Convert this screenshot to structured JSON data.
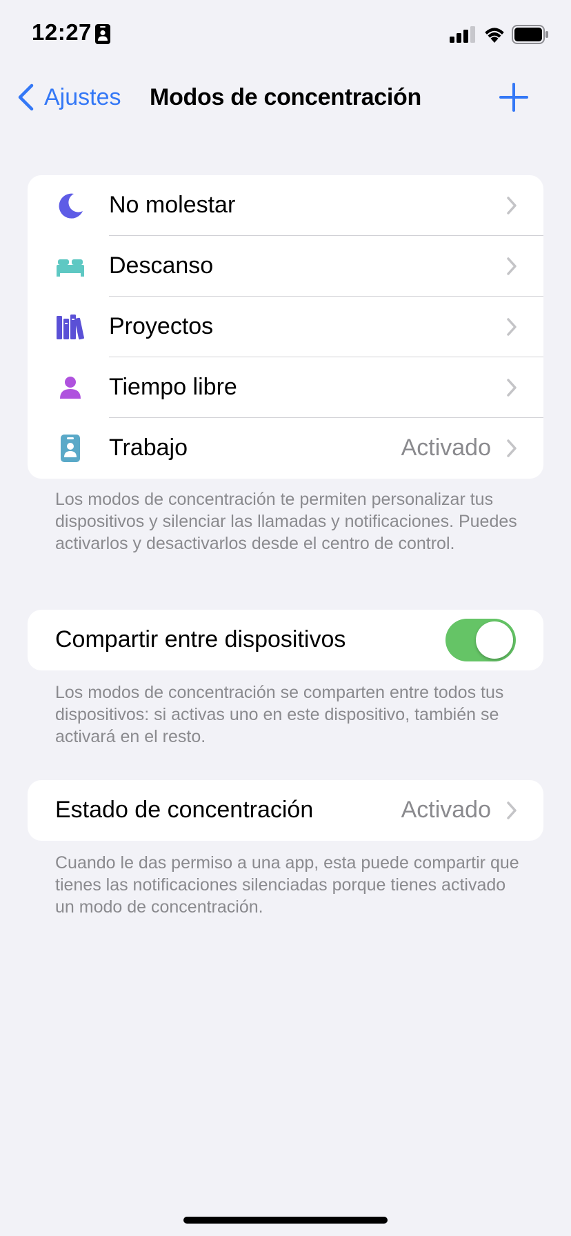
{
  "status_bar": {
    "time": "12:27",
    "icons": [
      "focus-work-icon",
      "signal-icon",
      "wifi-icon",
      "battery-icon"
    ]
  },
  "nav": {
    "back_label": "Ajustes",
    "title": "Modos de concentración",
    "add_icon": "plus-icon"
  },
  "colors": {
    "accent": "#3478f6",
    "toggle_on": "#65c466",
    "secondary_text": "#8a8a8e",
    "background": "#f2f2f7",
    "moon": "#5e5ce6",
    "bed": "#5ec8c3",
    "books": "#5a50d6",
    "person": "#af52de",
    "badge": "#5aa9c8"
  },
  "modes": [
    {
      "label": "No molestar",
      "icon": "moon-icon",
      "value": ""
    },
    {
      "label": "Descanso",
      "icon": "bed-icon",
      "value": ""
    },
    {
      "label": "Proyectos",
      "icon": "books-icon",
      "value": ""
    },
    {
      "label": "Tiempo libre",
      "icon": "person-icon",
      "value": ""
    },
    {
      "label": "Trabajo",
      "icon": "id-badge-icon",
      "value": "Activado"
    }
  ],
  "modes_footnote": "Los modos de concentración te permiten personalizar tus dispositivos y silenciar las llamadas y notificaciones. Puedes activarlos y desactivarlos desde el centro de control.",
  "share": {
    "label": "Compartir entre dispositivos",
    "enabled": true
  },
  "share_footnote": "Los modos de concentración se comparten entre todos tus dispositivos: si activas uno en este dispositivo, también se activará en el resto.",
  "status": {
    "label": "Estado de concentración",
    "value": "Activado"
  },
  "status_footnote": "Cuando le das permiso a una app, esta puede compartir que tienes las notificaciones silenciadas porque tienes activado un modo de concentración."
}
